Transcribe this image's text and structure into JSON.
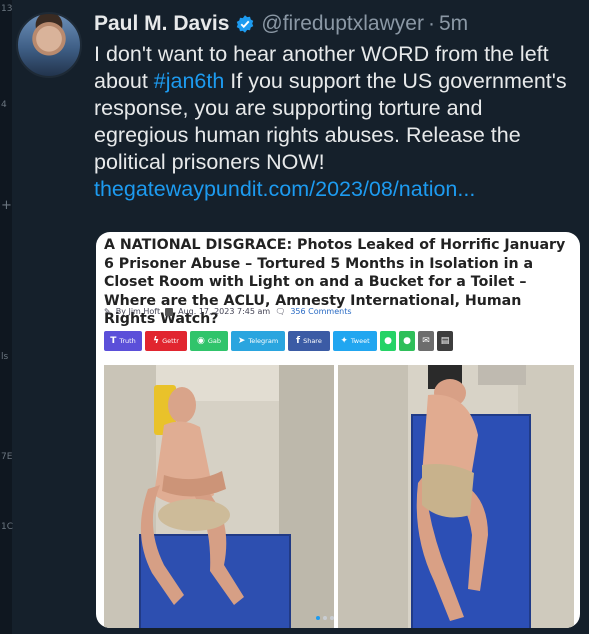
{
  "tweet": {
    "author_name": "Paul M. Davis",
    "handle": "@fireduptxlawyer",
    "separator": "·",
    "time": "5m",
    "text_part1": "I don't want to hear another WORD from the left about ",
    "hashtag": "#jan6th",
    "text_part2": " If you support the US government's response, you are supporting torture  and egregious human rights abuses. Release the political prisoners NOW!",
    "link": "thegatewaypundit.com/2023/08/nation..."
  },
  "article": {
    "headline": "A NATIONAL DISGRACE: Photos Leaked of Horrific January 6 Prisoner Abuse – Tortured 5 Months in Isolation in a Closet Room with Light on and a Bucket for a Toilet – Where are the ACLU, Amnesty International, Human Rights Watch?",
    "byline_author": "By Jim Hoft",
    "byline_date": "Aug. 17, 2023 7:45 am",
    "byline_comments": "356 Comments",
    "share_buttons": [
      {
        "label": "Truth",
        "glyph": "T",
        "color": "#5b4fd9"
      },
      {
        "label": "Gettr",
        "glyph": "ϟ",
        "color": "#e1252f"
      },
      {
        "label": "Gab",
        "glyph": "◉",
        "color": "#30c46b"
      },
      {
        "label": "Telegram",
        "glyph": "➤",
        "color": "#2aa5df"
      },
      {
        "label": "Share",
        "glyph": "f",
        "color": "#3b5ba5"
      },
      {
        "label": "Tweet",
        "glyph": "✦",
        "color": "#21a6f0"
      }
    ]
  },
  "colors": {
    "accent": "#1d9bf0",
    "background": "#15202b"
  },
  "gutter": [
    "13",
    "4",
    "+",
    "ls",
    "7E",
    "1C"
  ]
}
